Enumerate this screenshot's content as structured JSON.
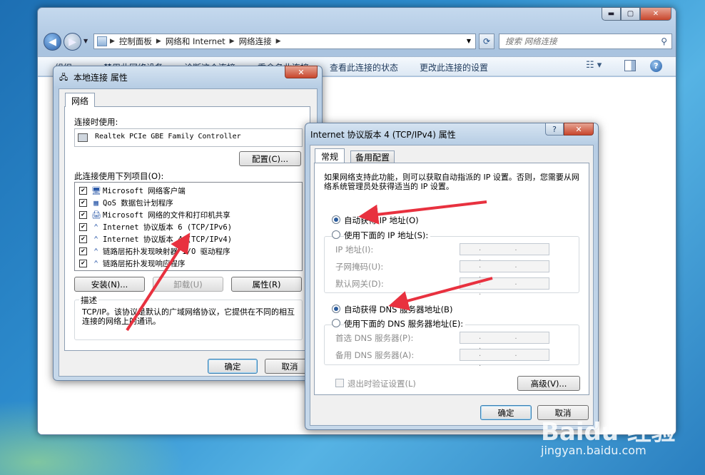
{
  "explorer": {
    "breadcrumbs": [
      "控制面板",
      "网络和 Internet",
      "网络连接"
    ],
    "search_placeholder": "搜索 网络连接",
    "toolbar": [
      "组织 ▾",
      "禁用此网络设备",
      "诊断这个连接",
      "重命名此连接",
      "查看此连接的状态",
      "更改此连接的设置"
    ]
  },
  "props": {
    "title": "本地连接 属性",
    "tab": "网络",
    "connect_using_label": "连接时使用:",
    "adapter": "Realtek PCIe GBE Family Controller",
    "configure_button": "配置(C)...",
    "items_label": "此连接使用下列项目(O):",
    "items": [
      {
        "label": "Microsoft 网络客户端",
        "checked": true,
        "icon": "network-client-icon"
      },
      {
        "label": "QoS 数据包计划程序",
        "checked": true,
        "icon": "qos-icon"
      },
      {
        "label": "Microsoft 网络的文件和打印机共享",
        "checked": true,
        "icon": "file-share-icon"
      },
      {
        "label": "Internet 协议版本 6 (TCP/IPv6)",
        "checked": true,
        "icon": "protocol-icon"
      },
      {
        "label": "Internet 协议版本 4 (TCP/IPv4)",
        "checked": true,
        "icon": "protocol-icon"
      },
      {
        "label": "链路层拓扑发现映射器 I/O 驱动程序",
        "checked": true,
        "icon": "protocol-icon"
      },
      {
        "label": "链路层拓扑发现响应程序",
        "checked": true,
        "icon": "protocol-icon"
      }
    ],
    "install_button": "安装(N)...",
    "uninstall_button": "卸载(U)",
    "properties_button": "属性(R)",
    "description_label": "描述",
    "description": "TCP/IP。该协议是默认的广域网络协议，它提供在不同的相互连接的网络上的通讯。",
    "ok": "确定",
    "cancel": "取消"
  },
  "ipv4": {
    "title": "Internet 协议版本 4 (TCP/IPv4) 属性",
    "help": "?",
    "tabs": [
      "常规",
      "备用配置"
    ],
    "intro": "如果网络支持此功能，则可以获取自动指派的 IP 设置。否则，您需要从网络系统管理员处获得适当的 IP 设置。",
    "auto_ip": "自动获得 IP 地址(O)",
    "manual_ip": "使用下面的 IP 地址(S):",
    "ip_label": "IP 地址(I):",
    "mask_label": "子网掩码(U):",
    "gateway_label": "默认网关(D):",
    "auto_dns": "自动获得 DNS 服务器地址(B)",
    "manual_dns": "使用下面的 DNS 服务器地址(E):",
    "pref_dns": "首选 DNS 服务器(P):",
    "alt_dns": "备用 DNS 服务器(A):",
    "ip_placeholder": ". . .",
    "validate": "退出时验证设置(L)",
    "advanced": "高级(V)...",
    "ok": "确定",
    "cancel": "取消",
    "selected": {
      "ip": "auto",
      "dns": "auto"
    }
  },
  "watermark": {
    "brand": "Baidu 经验",
    "url": "jingyan.baidu.com"
  },
  "colors": {
    "annotation_arrow": "#e8313f",
    "selection": "#2b5c9d"
  }
}
